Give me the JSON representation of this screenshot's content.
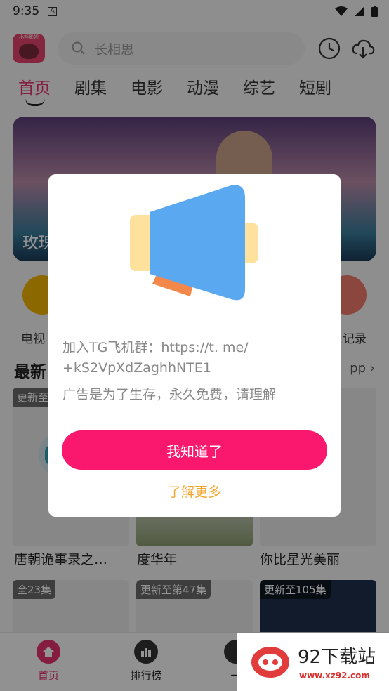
{
  "status": {
    "time": "9:35",
    "notif_letter": "A"
  },
  "logo": {
    "text": "小熊影视"
  },
  "search": {
    "placeholder": "长相思"
  },
  "tabs": [
    {
      "label": "首页",
      "active": true
    },
    {
      "label": "剧集"
    },
    {
      "label": "电影"
    },
    {
      "label": "动漫"
    },
    {
      "label": "综艺"
    },
    {
      "label": "短剧"
    }
  ],
  "banner": {
    "title": "玫瑰"
  },
  "shortcuts": {
    "left_label": "电视",
    "right_label": "记录"
  },
  "section": {
    "title": "最新",
    "more": "pp"
  },
  "cards": [
    {
      "badge": "更新至",
      "title": "唐朝诡事录之…"
    },
    {
      "badge": "",
      "title": "度华年"
    },
    {
      "badge": "",
      "title": "你比星光美丽"
    },
    {
      "badge": "全23集",
      "title": ""
    },
    {
      "badge": "更新至第47集",
      "title": ""
    },
    {
      "badge": "更新至105集",
      "title": ""
    }
  ],
  "bottom_nav": [
    {
      "label": "首页",
      "active": true
    },
    {
      "label": "排行榜"
    },
    {
      "label": "一"
    }
  ],
  "modal": {
    "line1": "加入TG飞机群：https://t. me/",
    "line2": "+kS2VpXdZaghhNTE1",
    "line3": "广告是为了生存，永久免费，请理解",
    "ok_button": "我知道了",
    "more_link": "了解更多"
  },
  "watermark": {
    "title": "92下载站",
    "url": "www.xz92.com"
  },
  "colors": {
    "accent": "#fa176e",
    "tab_active": "#e6336e",
    "link": "#f4a52d"
  }
}
